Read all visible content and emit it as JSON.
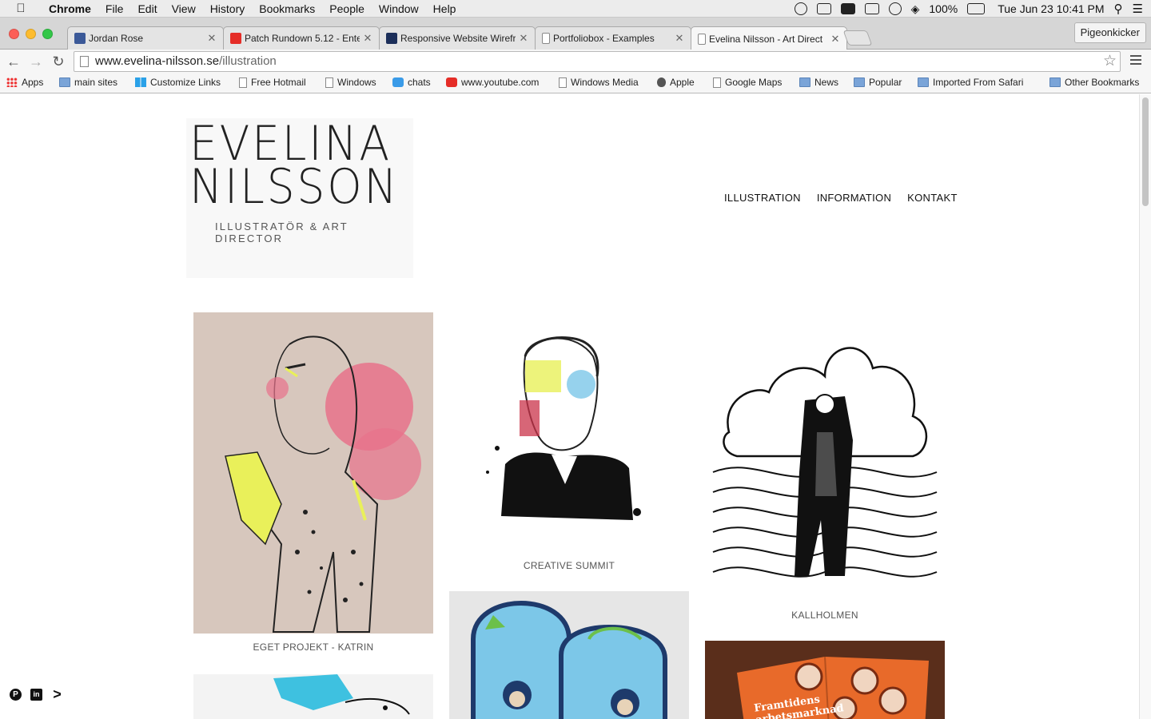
{
  "mac_menu": {
    "app": "Chrome",
    "items": [
      "File",
      "Edit",
      "View",
      "History",
      "Bookmarks",
      "People",
      "Window",
      "Help"
    ],
    "battery": "100%",
    "clock": "Tue Jun 23  10:41 PM"
  },
  "tabs": [
    {
      "title": "Jordan Rose",
      "favicon_color": "#3b5998"
    },
    {
      "title": "Patch Rundown 5.12 - Ente",
      "favicon_color": "#e52d27"
    },
    {
      "title": "Responsive Website Wirefr",
      "favicon_color": "#1c2f5a"
    },
    {
      "title": "Portfoliobox - Examples",
      "favicon_color": "#ffffff"
    },
    {
      "title": "Evelina Nilsson - Art Direct",
      "favicon_color": "#ffffff"
    }
  ],
  "profile_name": "Pigeonkicker",
  "address": {
    "domain": "www.evelina-nilsson.se",
    "path": "/illustration"
  },
  "bookmarks": [
    "Apps",
    "main sites",
    "Customize Links",
    "Free Hotmail",
    "Windows",
    "chats",
    "www.youtube.com",
    "Windows Media",
    "Apple",
    "Google Maps",
    "News",
    "Popular",
    "Imported From Safari",
    "Other Bookmarks"
  ],
  "site": {
    "logo_line1": "EVELINA",
    "logo_line2": "NILSSON",
    "logo_sub": "ILLUSTRATÖR & ART DIRECTOR",
    "nav": [
      "ILLUSTRATION",
      "INFORMATION",
      "KONTAKT"
    ],
    "gallery": [
      {
        "caption": "EGET PROJEKT - KATRIN"
      },
      {
        "caption": "CREATIVE SUMMIT"
      },
      {
        "caption": "KALLHOLMEN"
      },
      {
        "caption": ""
      },
      {
        "caption": ""
      },
      {
        "caption": ""
      }
    ],
    "artwork_text": "Framtidens arbetsmarknad",
    "social": [
      "pinterest-icon",
      "linkedin-icon",
      "portfolio-arrow-icon"
    ]
  },
  "colors": {
    "accent_pink": "#e8728b",
    "neon_yellow": "#e9f05a",
    "beige": "#d7c7bd",
    "sky_blue": "#7cc7e8"
  }
}
